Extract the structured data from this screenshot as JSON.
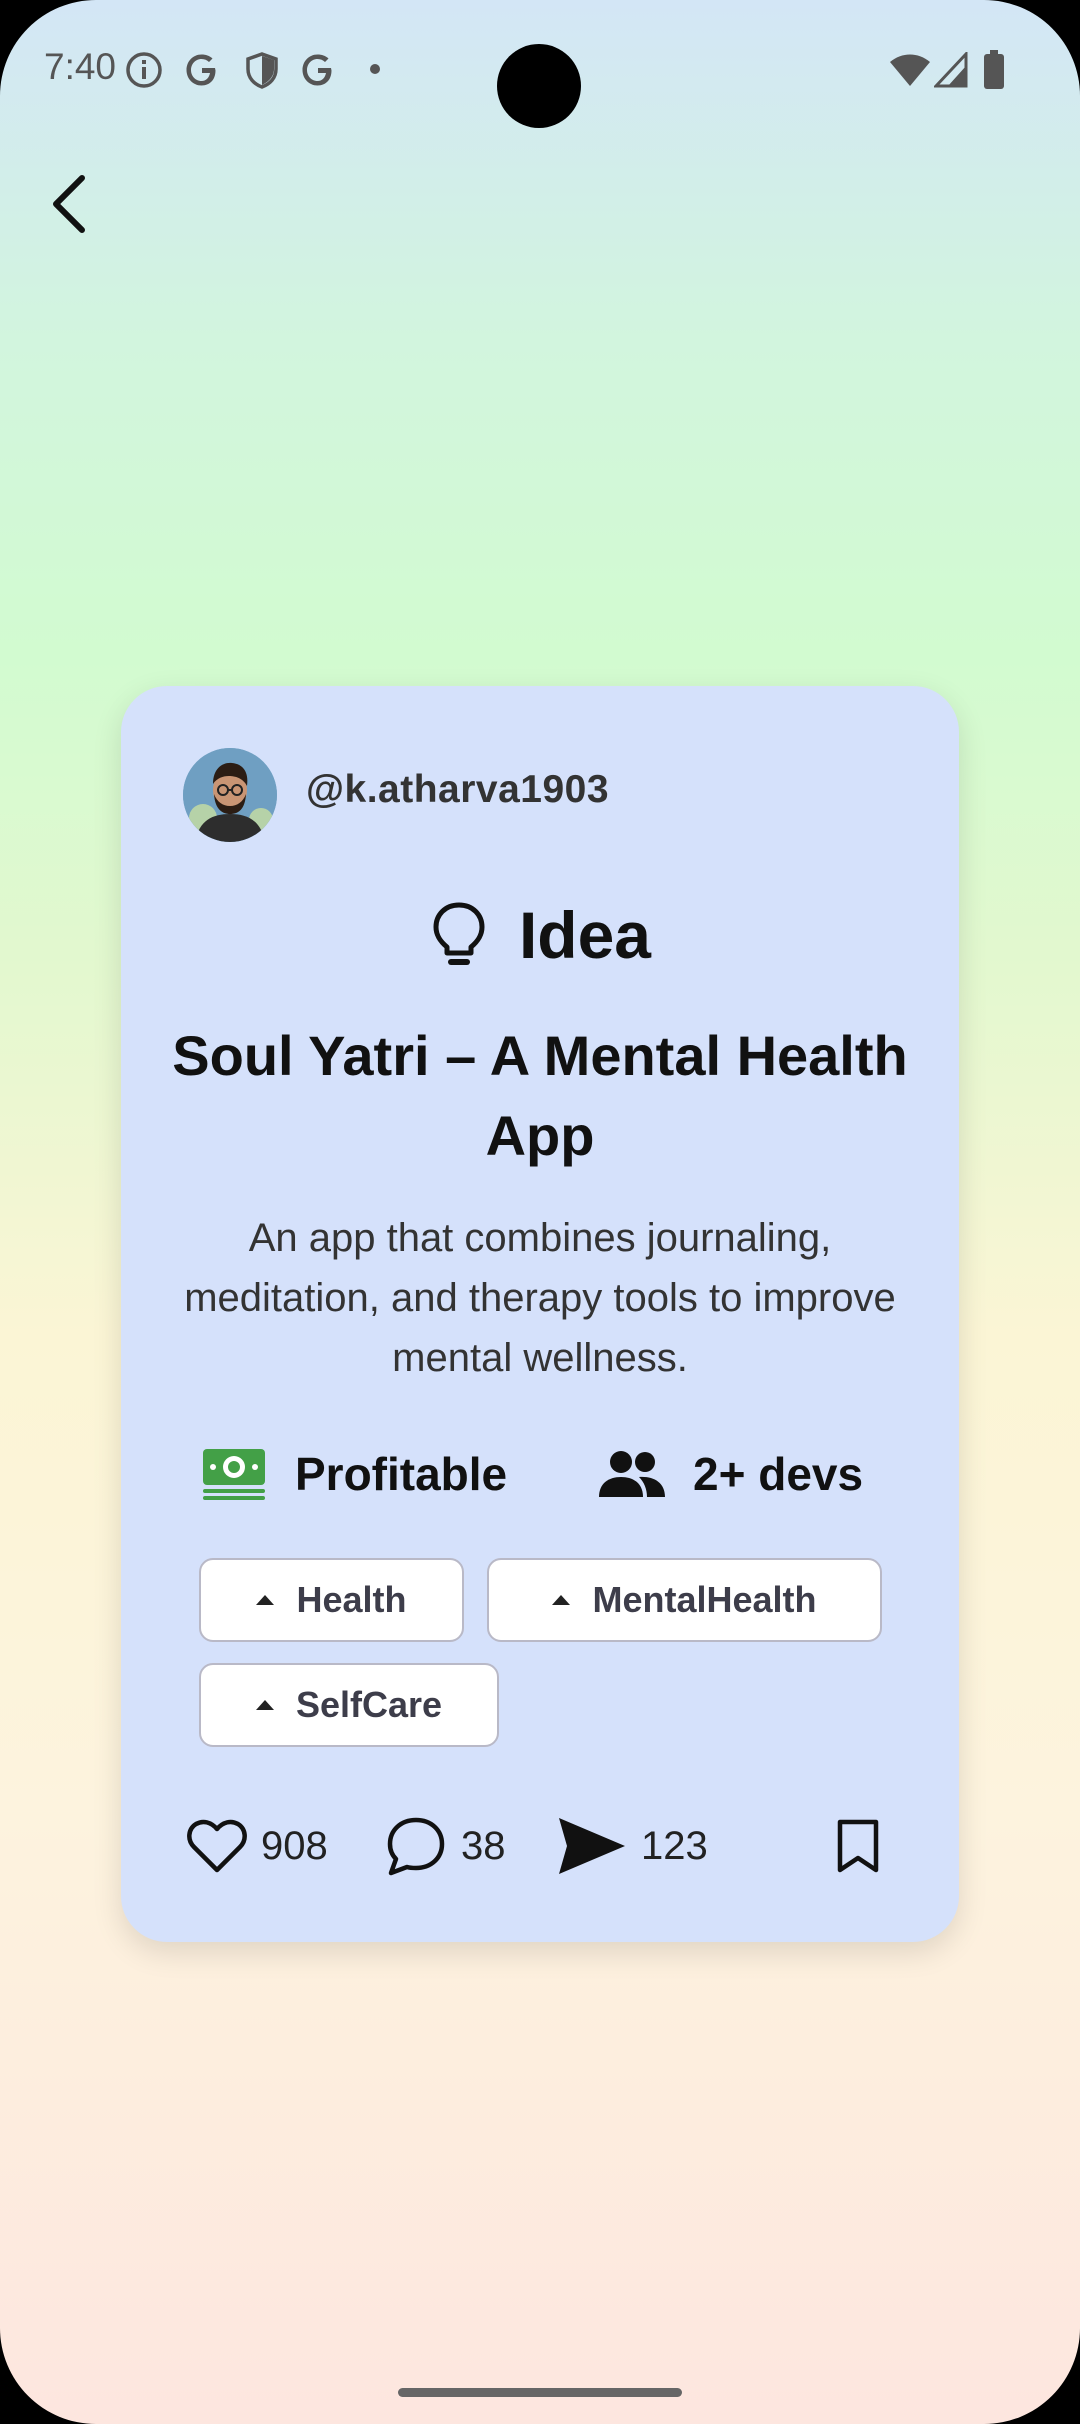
{
  "status_bar": {
    "time": "7:40",
    "left_icons": [
      "info-icon",
      "google-icon",
      "shield-icon",
      "google-icon",
      "dot-icon"
    ],
    "right_icons": [
      "wifi-icon",
      "signal-icon",
      "battery-icon"
    ]
  },
  "nav": {
    "back_icon": "chevron-left-icon"
  },
  "post": {
    "username": "@k.atharva1903",
    "type_label": "Idea",
    "type_icon": "lightbulb-icon",
    "title": "Soul Yatri – A Mental Health App",
    "description": "An app that combines journaling, meditation, and therapy tools to improve mental wellness.",
    "monetization": "Profitable",
    "team_size": "2+ devs",
    "tags": [
      "Health",
      "MentalHealth",
      "SelfCare"
    ],
    "likes": "908",
    "comments": "38",
    "shares": "123"
  },
  "colors": {
    "card_bg": "#d5e1fb",
    "money_green": "#43a047",
    "chip_border": "#b9b9c7"
  }
}
